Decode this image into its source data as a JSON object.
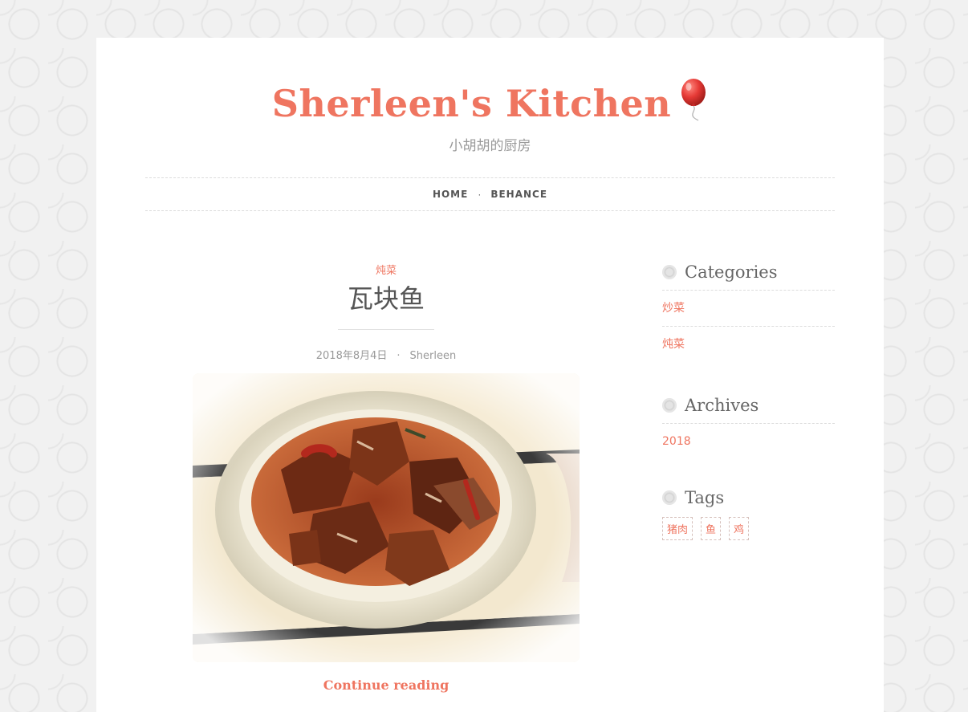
{
  "site": {
    "title": "Sherleen's Kitchen",
    "tagline": "小胡胡的厨房",
    "accent_color": "#ef7560",
    "title_icon": "balloon-icon"
  },
  "nav": {
    "items": [
      {
        "label": "HOME"
      },
      {
        "label": "BEHANCE"
      }
    ],
    "separator": "·"
  },
  "post": {
    "category": "炖菜",
    "title": "瓦块鱼",
    "date": "2018年8月4日",
    "meta_separator": "·",
    "author": "Sherleen",
    "image_alt": "瓦块鱼",
    "continue_label": "Continue reading"
  },
  "sidebar": {
    "categories": {
      "title": "Categories",
      "items": [
        {
          "label": "炒菜"
        },
        {
          "label": "炖菜"
        }
      ]
    },
    "archives": {
      "title": "Archives",
      "items": [
        {
          "label": "2018"
        }
      ]
    },
    "tags": {
      "title": "Tags",
      "items": [
        {
          "label": "猪肉"
        },
        {
          "label": "鱼"
        },
        {
          "label": "鸡"
        }
      ]
    }
  }
}
